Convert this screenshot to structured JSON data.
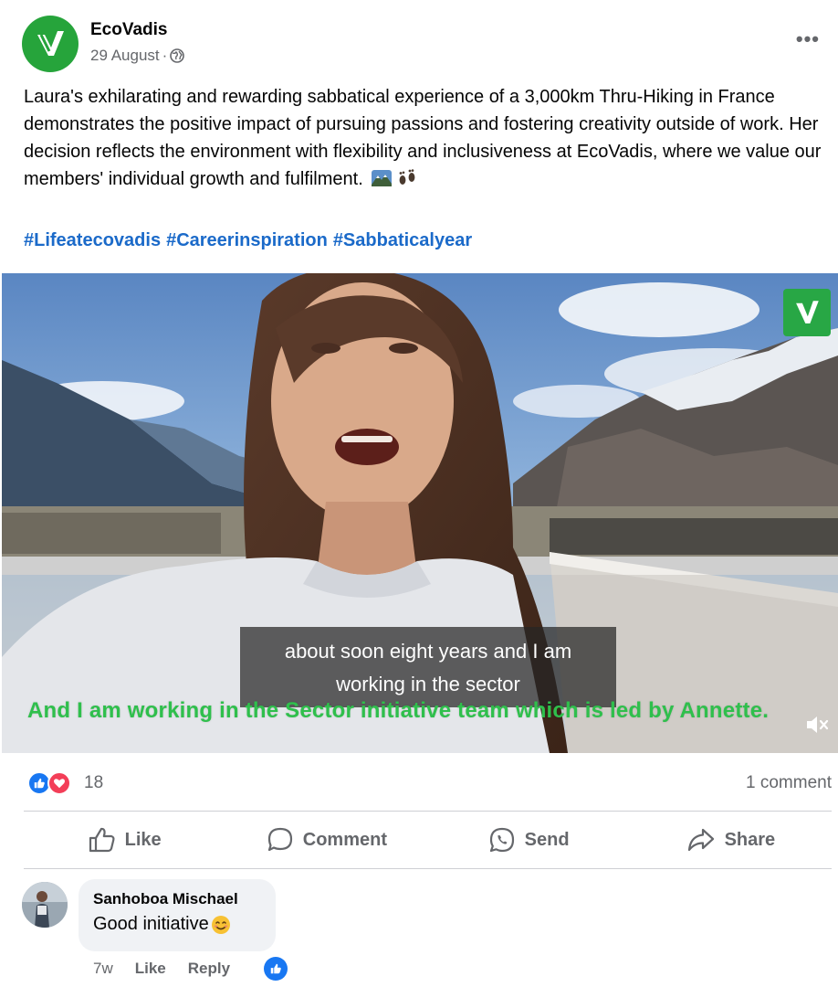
{
  "post": {
    "author": "EcoVadis",
    "date": "29 August",
    "separator": "·",
    "privacy_icon": "globe-icon",
    "more_icon": "more-options-icon",
    "caption": "Laura's exhilarating and rewarding sabbatical experience of a 3,000km Thru-Hiking in France demonstrates the positive impact of pursuing passions and fostering creativity outside of work. Her decision reflects the environment with flexibility and inclusiveness at EcoVadis, where we value our members' individual growth and fulfilment.",
    "caption_emojis": [
      "mountain-landscape-icon",
      "footprints-icon"
    ],
    "hashtags": [
      "#Lifeatecovadis",
      "#Careerinspiration",
      "#Sabbaticalyear"
    ],
    "brand_color": "#26a43b",
    "link_color": "#1b6ac9"
  },
  "video": {
    "subtitle_line1": "about soon eight years and I am",
    "subtitle_line2": "working in the sector",
    "burned_subtitle": "And I am working in the Sector initiative team which is led by Annette.",
    "mute_icon": "muted-speaker-icon",
    "overlay_logo": "ecovadis-logo-icon",
    "burned_subtitle_color": "#2fbf4c"
  },
  "stats": {
    "reaction_icons": [
      "like-reaction-icon",
      "love-reaction-icon"
    ],
    "reaction_count": "18",
    "comment_count": "1 comment"
  },
  "actions": {
    "like": "Like",
    "comment": "Comment",
    "send": "Send",
    "share": "Share"
  },
  "comment": {
    "author": "Sanhoboa Mischael",
    "text": "Good initiative",
    "emoji": "smiling-face-icon",
    "age": "7w",
    "like_label": "Like",
    "reply_label": "Reply",
    "reaction_icon": "like-reaction-icon"
  }
}
